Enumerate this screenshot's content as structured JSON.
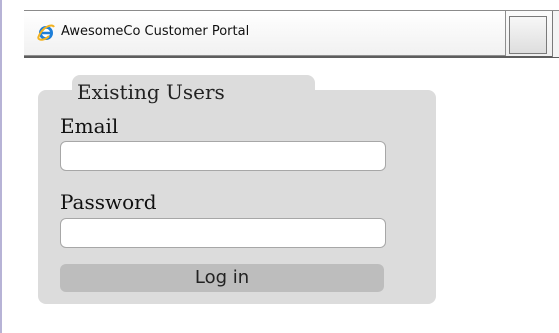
{
  "window": {
    "tab_title": "AwesomeCo Customer Portal"
  },
  "icons": {
    "browser": "ie-icon"
  },
  "login_form": {
    "legend": "Existing Users",
    "email_label": "Email",
    "email_value": "",
    "email_placeholder": "",
    "password_label": "Password",
    "password_value": "",
    "password_placeholder": "",
    "submit_label": "Log in"
  },
  "colors": {
    "panel": "#dcdcdc",
    "button": "#bdbdbd"
  }
}
